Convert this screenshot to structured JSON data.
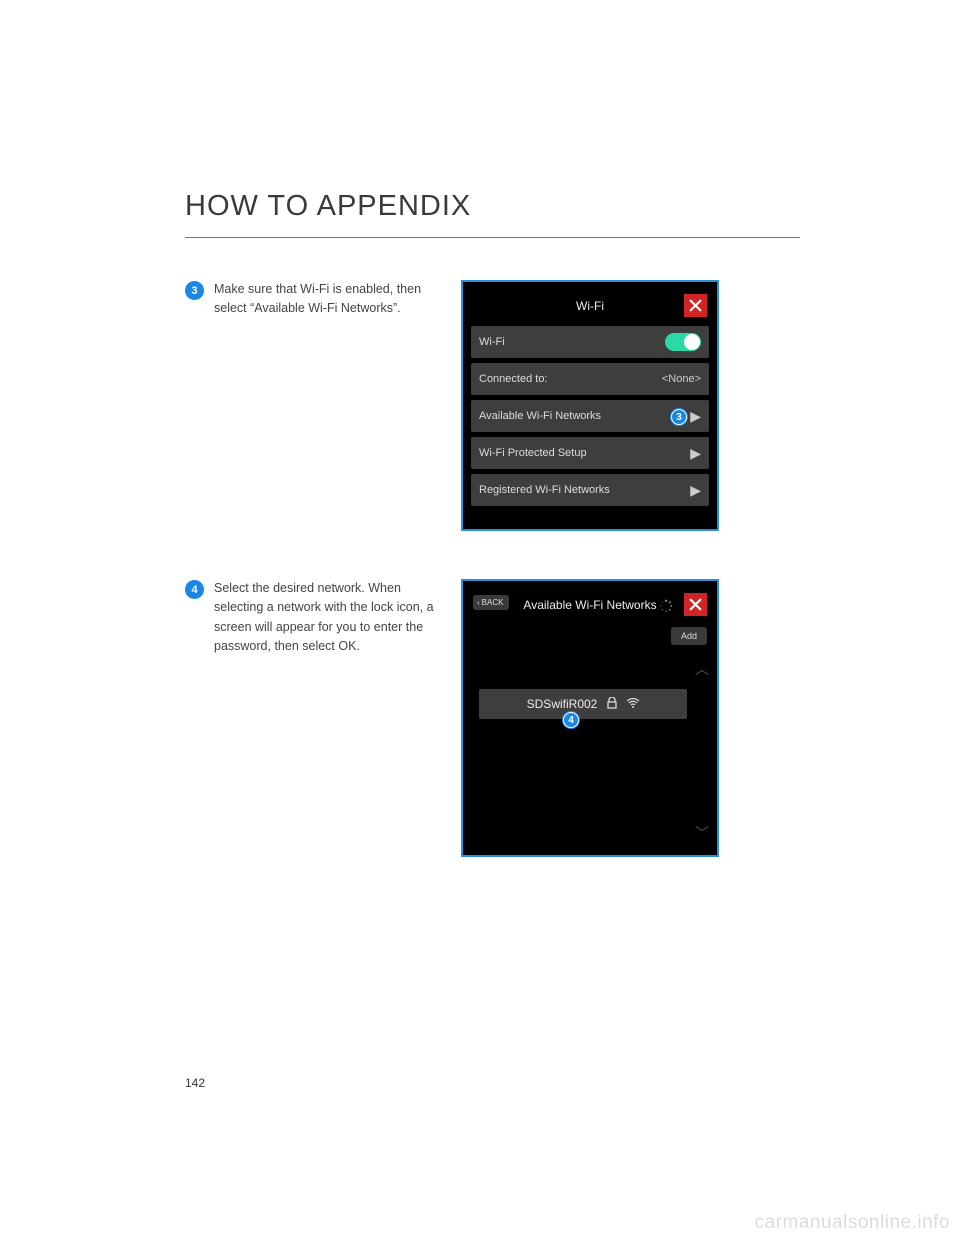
{
  "page": {
    "title": "HOW TO APPENDIX",
    "number": "142",
    "watermark": "carmanualsonline.info"
  },
  "steps": [
    {
      "num": "3",
      "text": "Make sure that Wi-Fi is enabled, then select “Available Wi-Fi Networks”."
    },
    {
      "num": "4",
      "text": "Select the desired network. When selecting a network with the lock icon, a screen will appear for you to enter the password, then select OK."
    }
  ],
  "screen1": {
    "title": "Wi-Fi",
    "rows": {
      "wifi_label": "Wi-Fi",
      "connected_label": "Connected to:",
      "connected_value": "<None>",
      "available_label": "Available Wi-Fi Networks",
      "wps_label": "Wi-Fi Protected Setup",
      "registered_label": "Registered Wi-Fi Networks"
    },
    "callout": "3"
  },
  "screen2": {
    "back_label": "BACK",
    "title": "Available Wi-Fi Networks",
    "add_label": "Add",
    "network_name": "SDSwifiR002",
    "callout": "4"
  }
}
